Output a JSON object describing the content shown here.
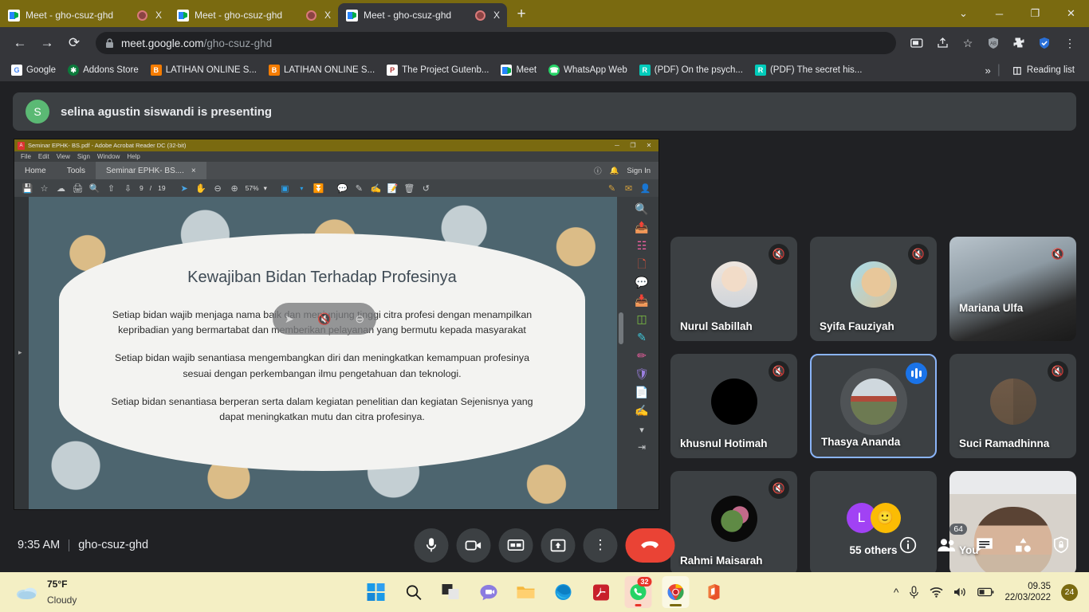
{
  "browser": {
    "tabs": [
      {
        "title": "Meet - gho-csuz-ghd",
        "favicon": "meet-icon",
        "active": false
      },
      {
        "title": "Meet - gho-csuz-ghd",
        "favicon": "meet-icon",
        "active": false
      },
      {
        "title": "Meet - gho-csuz-ghd",
        "favicon": "meet-icon",
        "active": true
      }
    ],
    "new_tab_label": "+",
    "close_label": "X",
    "window_controls": {
      "minimize": "─",
      "maximize": "❐",
      "close": "✕",
      "chevron": "⌄"
    },
    "nav": {
      "back": "←",
      "forward": "→",
      "reload": "⟳"
    },
    "omnibox": {
      "lock_icon": "lock-icon",
      "domain": "meet.google.com",
      "path": "/gho-csuz-ghd"
    },
    "toolbar_icons": [
      "cast-icon",
      "share-icon",
      "bookmark-star-icon",
      "adblock-icon",
      "extensions-icon",
      "shield-check-icon",
      "more-menu-icon"
    ],
    "bookmarks": [
      {
        "label": "Google",
        "icon": "google-icon",
        "color": "#ffffff"
      },
      {
        "label": "Addons Store",
        "icon": "addons-icon",
        "color": "#0b7a3b"
      },
      {
        "label": "LATIHAN ONLINE S...",
        "icon": "blogger-icon",
        "color": "#f57c00"
      },
      {
        "label": "LATIHAN ONLINE S...",
        "icon": "blogger-icon",
        "color": "#f57c00"
      },
      {
        "label": "The Project Gutenb...",
        "icon": "gutenberg-icon",
        "color": "#ffffff"
      },
      {
        "label": "Meet",
        "icon": "meet-icon",
        "color": "#ffffff"
      },
      {
        "label": "WhatsApp Web",
        "icon": "whatsapp-icon",
        "color": "#25d366"
      },
      {
        "label": "(PDF) On the psych...",
        "icon": "researchgate-icon",
        "color": "#00ccbb"
      },
      {
        "label": "(PDF) The secret his...",
        "icon": "researchgate-icon",
        "color": "#00ccbb"
      }
    ],
    "overflow_label": "»",
    "reading_list_label": "Reading list"
  },
  "meet": {
    "presenting_banner": {
      "avatar_initial": "S",
      "text": "selina agustin siswandi is presenting"
    },
    "tiles": [
      {
        "name": "Nurul Sabillah",
        "muted": true,
        "type": "avatar",
        "active": false
      },
      {
        "name": "Syifa Fauziyah",
        "muted": true,
        "type": "avatar",
        "active": false
      },
      {
        "name": "Mariana Ulfa",
        "muted": true,
        "type": "video",
        "active": false
      },
      {
        "name": "khusnul Hotimah",
        "muted": true,
        "type": "avatar",
        "active": false
      },
      {
        "name": "Thasya Ananda",
        "muted": false,
        "type": "avatar",
        "active": true
      },
      {
        "name": "Suci Ramadhinna",
        "muted": true,
        "type": "avatar",
        "active": false
      },
      {
        "name": "Rahmi Maisarah",
        "muted": true,
        "type": "avatar",
        "active": false
      },
      {
        "name": "55 others",
        "muted": false,
        "type": "others",
        "active": false,
        "avatar_initial": "L",
        "emoji": "🙂"
      },
      {
        "name": "You",
        "muted": false,
        "type": "video",
        "active": false
      }
    ],
    "bottom_bar": {
      "time": "9:35 AM",
      "meeting_code": "gho-csuz-ghd",
      "controls": [
        {
          "name": "microphone-button",
          "icon": "mic-icon"
        },
        {
          "name": "camera-button",
          "icon": "camera-icon"
        },
        {
          "name": "captions-button",
          "icon": "closed-caption-icon"
        },
        {
          "name": "present-now-button",
          "icon": "present-screen-icon"
        },
        {
          "name": "more-options-button",
          "icon": "more-vertical-icon"
        },
        {
          "name": "leave-call-button",
          "icon": "hang-up-icon"
        }
      ],
      "right_controls": [
        {
          "name": "meeting-details-button",
          "icon": "info-icon",
          "badge": ""
        },
        {
          "name": "show-everyone-button",
          "icon": "people-icon",
          "badge": "64"
        },
        {
          "name": "chat-button",
          "icon": "chat-icon",
          "badge": ""
        },
        {
          "name": "activities-button",
          "icon": "activities-icon",
          "badge": ""
        },
        {
          "name": "host-controls-button",
          "icon": "shield-lock-icon",
          "badge": ""
        }
      ]
    }
  },
  "acrobat": {
    "window_title": "Seminar EPHK- BS.pdf - Adobe Acrobat Reader DC (32-bit)",
    "window_buttons": {
      "minimize": "─",
      "restore": "❐",
      "close": "✕"
    },
    "menu": [
      "File",
      "Edit",
      "View",
      "Sign",
      "Window",
      "Help"
    ],
    "tabs": [
      {
        "label": "Home"
      },
      {
        "label": "Tools"
      },
      {
        "label": "Seminar EPHK- BS....",
        "selected": true,
        "close": "×"
      }
    ],
    "tab_right": {
      "help_icon": "help-circle-icon",
      "bell_icon": "bell-icon",
      "sign_in": "Sign In"
    },
    "toolbar": {
      "icons_left": [
        "save-icon",
        "star-icon",
        "upload-cloud-icon",
        "print-icon",
        "search-icon",
        "prev-page-icon",
        "next-page-icon"
      ],
      "page_current": "9",
      "page_sep": "/",
      "page_total": "19",
      "icons_mid": [
        "select-cursor-icon",
        "hand-tool-icon",
        "zoom-out-icon",
        "zoom-in-icon"
      ],
      "zoom_level": "57%",
      "zoom_caret": "▾",
      "icons_right": [
        "fit-page-icon",
        "page-fit-width-icon",
        "comment-icon",
        "highlight-icon",
        "sign-icon",
        "stamp-icon",
        "delete-icon",
        "rotate-icon"
      ],
      "icons_far_right": [
        "protect-icon",
        "email-icon",
        "account-icon"
      ]
    },
    "right_rail": [
      {
        "name": "search-tool",
        "icon": "magnifier-icon",
        "color": "#d8dadd"
      },
      {
        "name": "export-pdf-tool",
        "icon": "export-pdf-icon",
        "color": "#3ec6d8"
      },
      {
        "name": "organize-pages-tool",
        "icon": "organize-pages-icon",
        "color": "#ef5fa0"
      },
      {
        "name": "create-pdf-tool",
        "icon": "create-pdf-icon",
        "color": "#e8553c"
      },
      {
        "name": "comment-tool",
        "icon": "comment-bubble-icon",
        "color": "#f2c230"
      },
      {
        "name": "combine-files-tool",
        "icon": "combine-files-icon",
        "color": "#7b83e8"
      },
      {
        "name": "compress-pdf-tool",
        "icon": "compress-pdf-icon",
        "color": "#7dc242"
      },
      {
        "name": "edit-pdf-tool",
        "icon": "edit-pdf-icon",
        "color": "#3ec6d8"
      },
      {
        "name": "fill-sign-tool",
        "icon": "fill-sign-icon",
        "color": "#ef5fa0"
      },
      {
        "name": "protect-tool",
        "icon": "shield-icon",
        "color": "#9b7fe0"
      },
      {
        "name": "scan-ocr-tool",
        "icon": "scan-ocr-icon",
        "color": "#d66bd0"
      },
      {
        "name": "request-signature-tool",
        "icon": "signature-icon",
        "color": "#9b7fe0"
      },
      {
        "name": "expand-rail",
        "icon": "chevron-down-icon",
        "color": "#c6c9cb"
      },
      {
        "name": "collapse-panel",
        "icon": "collapse-panel-icon",
        "color": "#c6c9cb"
      }
    ],
    "slide": {
      "title": "Kewajiban Bidan Terhadap Profesinya",
      "paragraphs": [
        "Setiap  bidan wajib menjaga nama baik dan menjunjung tinggi citra profesi dengan menampilkan kepribadian yang bermartabat dan memberikan pelayanan yang bermutu kepada masyarakat",
        "Setiap  bidan wajib senantiasa mengembangkan diri dan meningkatkan kemampuan profesinya sesuai dengan perkembangan ilmu pengetahuan dan teknologi.",
        "Setiap bidan senantiasa berperan serta dalam kegiatan penelitian dan kegiatan Sejenisnya yang dapat meningkatkan mutu dan citra profesinya."
      ]
    }
  },
  "taskbar": {
    "weather": {
      "temperature": "75°F",
      "condition": "Cloudy",
      "icon": "cloud-icon"
    },
    "apps": [
      {
        "name": "start-button",
        "icon": "windows-logo-icon"
      },
      {
        "name": "search-button",
        "icon": "search-icon"
      },
      {
        "name": "task-view-button",
        "icon": "task-view-icon"
      },
      {
        "name": "chat-teams-button",
        "icon": "teams-chat-icon"
      },
      {
        "name": "file-explorer-button",
        "icon": "folder-icon"
      },
      {
        "name": "edge-button",
        "icon": "edge-icon"
      },
      {
        "name": "acrobat-button",
        "icon": "acrobat-icon"
      },
      {
        "name": "whatsapp-button",
        "icon": "whatsapp-icon",
        "badge": "32"
      },
      {
        "name": "chrome-button",
        "icon": "chrome-icon"
      },
      {
        "name": "office-button",
        "icon": "office-icon"
      }
    ],
    "tray_icons": [
      "show-hidden-icons",
      "microphone-icon",
      "wifi-icon",
      "volume-icon",
      "battery-icon"
    ],
    "clock": {
      "time": "09.35",
      "date": "22/03/2022"
    },
    "notification_badge": "24"
  }
}
